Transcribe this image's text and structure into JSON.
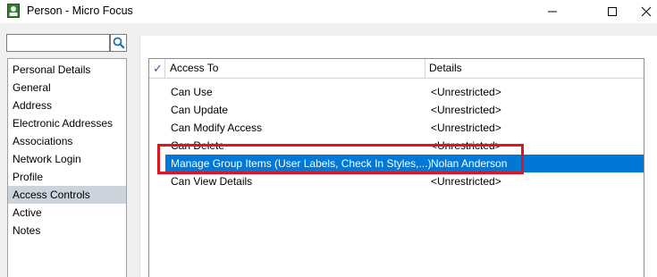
{
  "window": {
    "title": "Person - Micro Focus"
  },
  "search": {
    "value": "",
    "placeholder": ""
  },
  "nav": {
    "items": [
      "Personal Details",
      "General",
      "Address",
      "Electronic Addresses",
      "Associations",
      "Network Login",
      "Profile",
      "Access Controls",
      "Active",
      "Notes"
    ],
    "selected": "Access Controls"
  },
  "grid": {
    "headers": {
      "access_to": "Access To",
      "details": "Details"
    },
    "rows": [
      {
        "access": "Can Use",
        "details": "<Unrestricted>"
      },
      {
        "access": "Can Update",
        "details": "<Unrestricted>"
      },
      {
        "access": "Can Modify Access",
        "details": "<Unrestricted>"
      },
      {
        "access": "Can Delete",
        "details": "<Unrestricted>"
      },
      {
        "access": "Manage Group Items (User Labels, Check In Styles,...)",
        "details": "Nolan Anderson"
      },
      {
        "access": "Can View Details",
        "details": "<Unrestricted>"
      }
    ],
    "selected_row": "Manage Group Items (User Labels, Check In Styles,...)"
  },
  "colors": {
    "selection": "#0078d7",
    "nav_selection": "#cdd3dc",
    "highlight": "#e0141e",
    "check": "#7a2ca8"
  }
}
